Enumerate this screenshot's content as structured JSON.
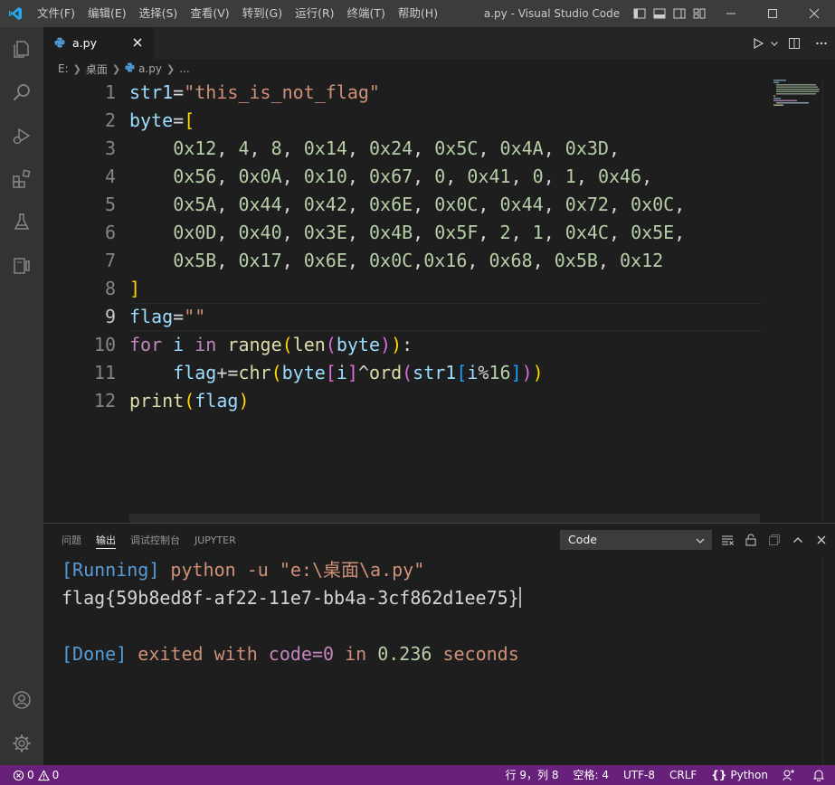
{
  "titlebar": {
    "menu": [
      "文件(F)",
      "编辑(E)",
      "选择(S)",
      "查看(V)",
      "转到(G)",
      "运行(R)",
      "终端(T)",
      "帮助(H)"
    ],
    "window_title": "a.py - Visual Studio Code"
  },
  "tabs": [
    {
      "label": "a.py",
      "active": true
    }
  ],
  "breadcrumb": {
    "drive": "E:",
    "folder": "桌面",
    "file": "a.py",
    "more": "..."
  },
  "editor": {
    "line_numbers": [
      "1",
      "2",
      "3",
      "4",
      "5",
      "6",
      "7",
      "8",
      "9",
      "10",
      "11",
      "12"
    ],
    "active_line": 9,
    "lines": [
      "str1=\"this_is_not_flag\"",
      "byte=[",
      "    0x12, 4, 8, 0x14, 0x24, 0x5C, 0x4A, 0x3D,",
      "    0x56, 0x0A, 0x10, 0x67, 0, 0x41, 0, 1, 0x46,",
      "    0x5A, 0x44, 0x42, 0x6E, 0x0C, 0x44, 0x72, 0x0C,",
      "    0x0D, 0x40, 0x3E, 0x4B, 0x5F, 2, 1, 0x4C, 0x5E,",
      "    0x5B, 0x17, 0x6E, 0x0C,0x16, 0x68, 0x5B, 0x12",
      "]",
      "flag=\"\"",
      "for i in range(len(byte)):",
      "    flag+=chr(byte[i]^ord(str1[i%16]))",
      "print(flag)"
    ]
  },
  "panel": {
    "tabs": [
      "问题",
      "输出",
      "调试控制台",
      "JUPYTER"
    ],
    "active_tab": "输出",
    "output_channel": "Code",
    "output_lines": [
      "[Running] python -u \"e:\\桌面\\a.py\"",
      "flag{59b8ed8f-af22-11e7-bb4a-3cf862d1ee75}",
      "",
      "[Done] exited with code=0 in 0.236 seconds"
    ]
  },
  "statusbar": {
    "errors": "0",
    "warnings": "0",
    "cursor_position": "行 9，列 8",
    "indent": "空格: 4",
    "encoding": "UTF-8",
    "eol": "CRLF",
    "language": "Python"
  },
  "colors": {
    "statusbar_bg": "#68217a",
    "titlebar_bg": "#3c3c3c",
    "activitybar_bg": "#333333",
    "editor_bg": "#1e1e1e",
    "accent_blue": "#569cd6"
  },
  "icons": {
    "activity": [
      "explorer-icon",
      "search-icon",
      "run-debug-icon",
      "extensions-icon",
      "testing-icon",
      "remote-explorer-icon",
      "account-icon",
      "settings-gear-icon"
    ]
  }
}
